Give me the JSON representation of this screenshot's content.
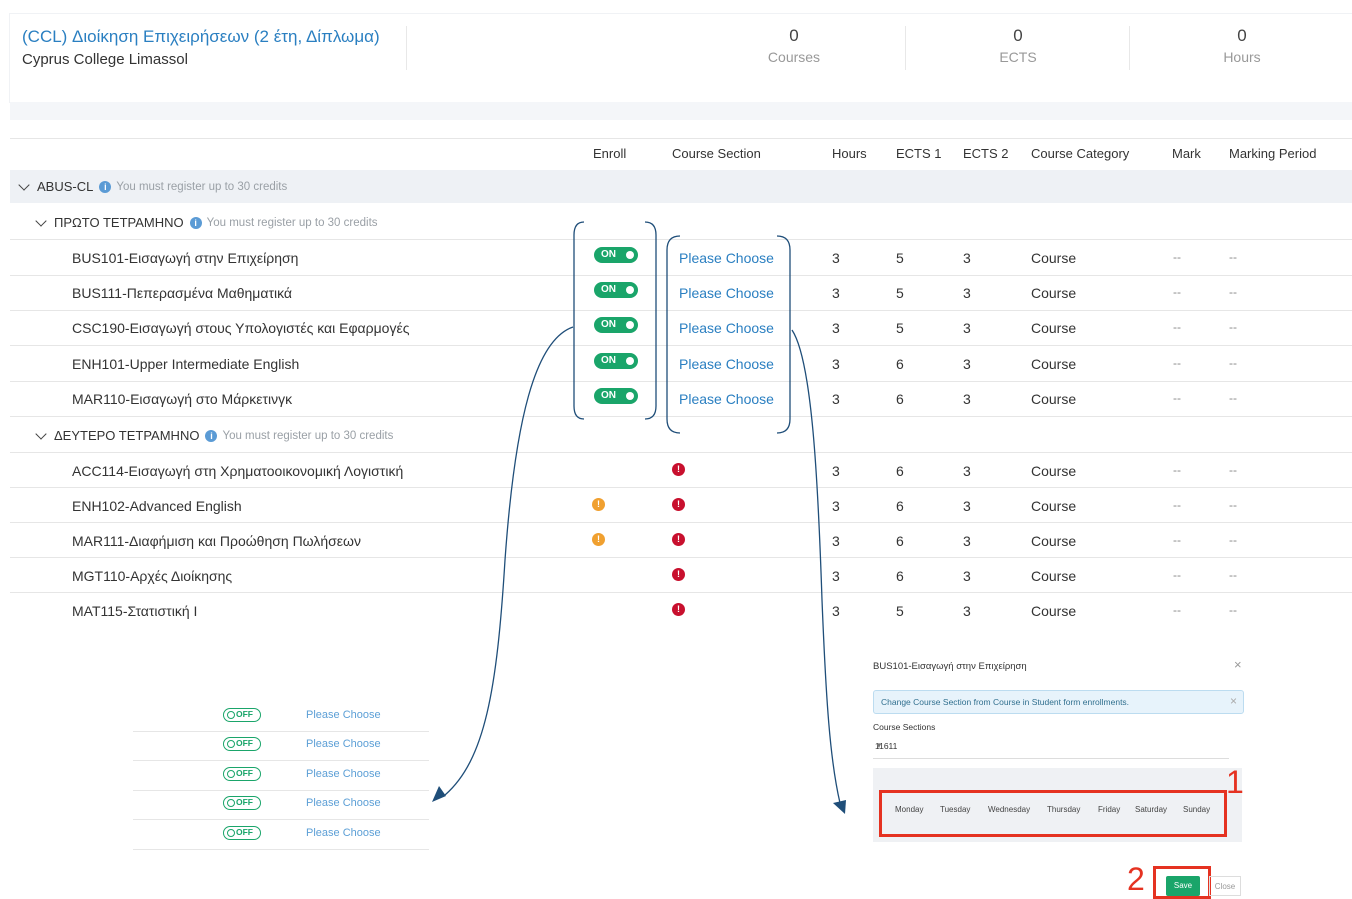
{
  "program": {
    "title": "(CCL) Διοίκηση Επιχειρήσεων (2 έτη, Δίπλωμα)",
    "school": "Cyprus College Limassol"
  },
  "stats": [
    {
      "value": "0",
      "label": "Courses"
    },
    {
      "value": "0",
      "label": "ECTS"
    },
    {
      "value": "0",
      "label": "Hours"
    }
  ],
  "table": {
    "headers": {
      "enroll": "Enroll",
      "section": "Course Section",
      "hours": "Hours",
      "ects1": "ECTS 1",
      "ects2": "ECTS 2",
      "category": "Course Category",
      "mark": "Mark",
      "period": "Marking Period"
    },
    "group": {
      "name": "ABUS-CL",
      "note": "You must register up to 30 credits"
    },
    "terms": [
      {
        "name": "ΠΡΩΤΟ ΤΕΤΡΑΜΗΝΟ",
        "note": "You must register up to 30 credits"
      },
      {
        "name": "ΔΕΥΤΕΡΟ ΤΕΤΡΑΜΗΝΟ",
        "note": "You must register up to 30 credits"
      }
    ],
    "rows": [
      {
        "course": "BUS101-Εισαγωγή στην Επιχείρηση",
        "enroll": "ON",
        "section": "Please Choose",
        "hours": "3",
        "ects1": "5",
        "ects2": "3",
        "category": "Course",
        "mark": "--",
        "period": "--"
      },
      {
        "course": "BUS111-Πεπερασμένα Μαθηματικά",
        "enroll": "ON",
        "section": "Please Choose",
        "hours": "3",
        "ects1": "5",
        "ects2": "3",
        "category": "Course",
        "mark": "--",
        "period": "--"
      },
      {
        "course": "CSC190-Εισαγωγή στους Υπολογιστές και Εφαρμογές",
        "enroll": "ON",
        "section": "Please Choose",
        "hours": "3",
        "ects1": "5",
        "ects2": "3",
        "category": "Course",
        "mark": "--",
        "period": "--"
      },
      {
        "course": "ENH101-Upper Intermediate English",
        "enroll": "ON",
        "section": "Please Choose",
        "hours": "3",
        "ects1": "6",
        "ects2": "3",
        "category": "Course",
        "mark": "--",
        "period": "--"
      },
      {
        "course": "MAR110-Εισαγωγή στο Μάρκετινγκ",
        "enroll": "ON",
        "section": "Please Choose",
        "hours": "3",
        "ects1": "6",
        "ects2": "3",
        "category": "Course",
        "mark": "--",
        "period": "--"
      },
      {
        "course": "ACC114-Εισαγωγή στη Χρηματοοικονομική Λογιστική",
        "hours": "3",
        "ects1": "6",
        "ects2": "3",
        "category": "Course",
        "mark": "--",
        "period": "--"
      },
      {
        "course": "ENH102-Advanced English",
        "hours": "3",
        "ects1": "6",
        "ects2": "3",
        "category": "Course",
        "mark": "--",
        "period": "--"
      },
      {
        "course": "MAR111-Διαφήμιση και Προώθηση Πωλήσεων",
        "hours": "3",
        "ects1": "6",
        "ects2": "3",
        "category": "Course",
        "mark": "--",
        "period": "--"
      },
      {
        "course": "MGT110-Αρχές Διοίκησης",
        "hours": "3",
        "ects1": "6",
        "ects2": "3",
        "category": "Course",
        "mark": "--",
        "period": "--"
      },
      {
        "course": "MAT115-Στατιστική Ι",
        "hours": "3",
        "ects1": "5",
        "ects2": "3",
        "category": "Course",
        "mark": "--",
        "period": "--"
      }
    ]
  },
  "mini_table": {
    "toggle_label": "OFF",
    "choose_label": "Please Choose"
  },
  "modal": {
    "title": "BUS101-Εισαγωγή στην Επιχείρηση",
    "alert": "Change Course Section from Course in Student form enrollments.",
    "sections_label": "Course Sections",
    "selected_section": "11611",
    "days": [
      "Monday",
      "Tuesday",
      "Wednesday",
      "Thursday",
      "Friday",
      "Saturday",
      "Sunday"
    ],
    "save_label": "Save",
    "close_label": "Close"
  },
  "annotations": {
    "label1": "1",
    "label2": "2"
  },
  "colors": {
    "accent": "#2a7fc1",
    "toggle_on": "#1aa56a",
    "error": "#c8102e",
    "warning": "#f0a030",
    "highlight": "#e53221",
    "annotation_line": "#1f4e79"
  }
}
